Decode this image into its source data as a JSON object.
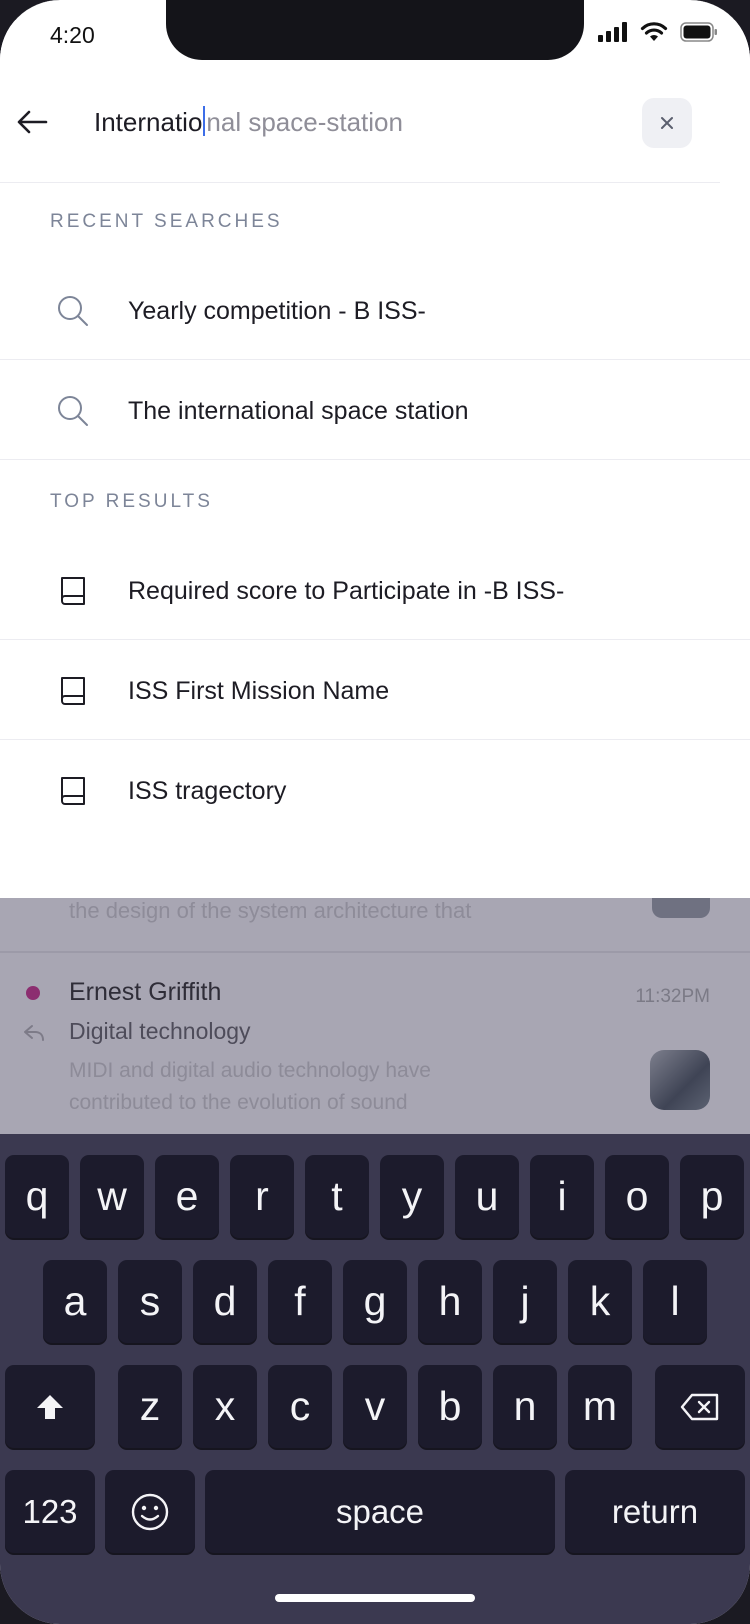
{
  "status": {
    "time": "4:20"
  },
  "search": {
    "typed": "Internatio",
    "suggestion": "nal space-station"
  },
  "recent": {
    "title": "RECENT SEARCHES",
    "items": [
      {
        "label": "Yearly competition - B ISS-",
        "icon": "search-icon"
      },
      {
        "label": "The international space station",
        "icon": "search-icon"
      }
    ]
  },
  "top": {
    "title": "TOP RESULTS",
    "items": [
      {
        "label": "Required score to Participate in -B ISS-",
        "icon": "book-icon"
      },
      {
        "label": "ISS First Mission Name",
        "icon": "book-icon"
      },
      {
        "label": "ISS tragectory",
        "icon": "book-icon"
      }
    ]
  },
  "background": {
    "prev_preview": "the design of the system architecture that",
    "message": {
      "sender": "Ernest Griffith",
      "time": "11:32PM",
      "subject": "Digital technology",
      "preview": "MIDI and digital audio technology have contributed to the evolution of sound"
    }
  },
  "keyboard": {
    "row1": [
      "q",
      "w",
      "e",
      "r",
      "t",
      "y",
      "u",
      "i",
      "o",
      "p"
    ],
    "row2": [
      "a",
      "s",
      "d",
      "f",
      "g",
      "h",
      "j",
      "k",
      "l"
    ],
    "row3": [
      "z",
      "x",
      "c",
      "v",
      "b",
      "n",
      "m"
    ],
    "numbers": "123",
    "space": "space",
    "return": "return"
  },
  "colors": {
    "caret": "#3d6ee8",
    "accent_dot": "#8c2e70",
    "keyboard_bg": "#3b3950",
    "key_bg": "#1c1b2c"
  }
}
